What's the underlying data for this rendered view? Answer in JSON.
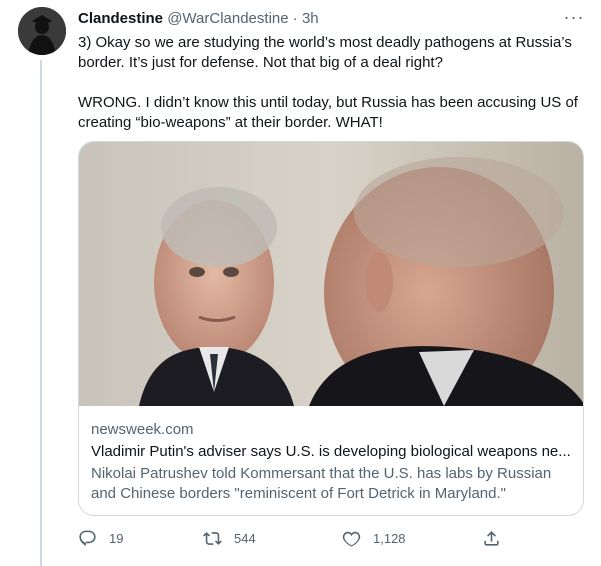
{
  "tweet": {
    "display_name": "Clandestine",
    "handle": "@WarClandestine",
    "separator": "·",
    "time": "3h",
    "more_label": "···",
    "text": "3) Okay so we are studying the world’s most deadly pathogens at Russia’s border. It’s just for defense. Not that big of a deal right?\n\nWRONG. I didn’t know this until today, but Russia has been accusing US of creating “bio-weapons” at their border. WHAT!"
  },
  "card": {
    "domain": "newsweek.com",
    "title": "Vladimir Putin's adviser says U.S. is developing biological weapons ne...",
    "description": "Nikolai Patrushev told Kommersant that the U.S. has labs by Russian and Chinese borders \"reminiscent of Fort Detrick in Maryland.\""
  },
  "actions": {
    "reply_count": "19",
    "retweet_count": "544",
    "like_count": "1,128"
  },
  "icons": {
    "avatar": "hooded-figure-avatar",
    "reply": "reply-icon",
    "retweet": "retweet-icon",
    "like": "heart-icon",
    "share": "share-icon"
  },
  "colors": {
    "text_primary": "#0f1419",
    "text_secondary": "#536471",
    "border": "#cfd9de"
  }
}
